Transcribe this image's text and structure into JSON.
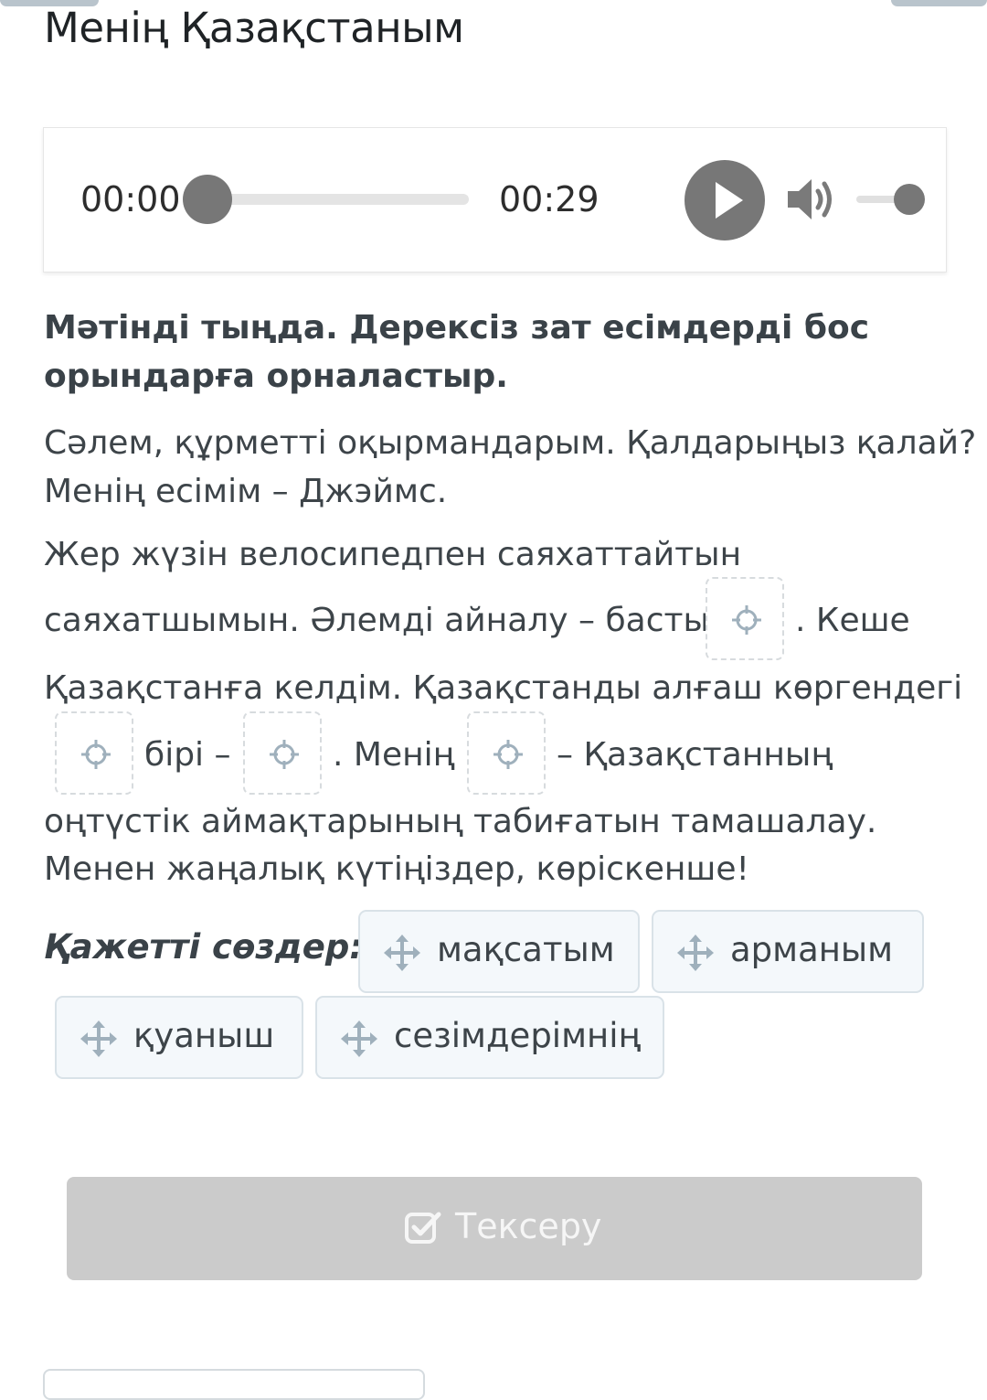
{
  "page": {
    "title": "Менің Қазақстаным"
  },
  "player": {
    "current_time": "00:00",
    "total_time": "00:29",
    "progress": 0.0,
    "volume": 1.0,
    "icons": {
      "play": "play-icon",
      "volume": "volume-icon"
    }
  },
  "exercise": {
    "instruction": "Мәтінді тыңда. Дерексіз зат есімдерді бос орындарға орналастыр.",
    "text": {
      "p1_line1": "Сәлем, құрметті оқырмандарым. Қалдарыңыз қалай?",
      "p1_line2": "Менің есімім – Джэймс.",
      "p2_line1": "Жер жүзін велосипедпен саяхаттайтын",
      "p2_line2_a": "саяхатшымын. Әлемді айналу – басты",
      "p2_line2_b": ". Кеше",
      "p2_line3": "Қазақстанға келдім. Қазақстанды алғаш көргендегі",
      "p2_line4_a": "бірі –",
      "p2_line4_b": ". Менің",
      "p2_line4_c": "– Қазақстанның",
      "p2_line5": "оңтүстік аймақтарының табиғатын тамашалау.",
      "p2_line6": "Менен жаңалық күтіңіздер, көріскенше!"
    },
    "words_label": "Қажетті сөздер:",
    "words": [
      "мақсатым",
      "арманым",
      "қуаныш",
      "сезімдерімнің"
    ],
    "check_button": "Тексеру"
  },
  "colors": {
    "control_gray": "#777777",
    "chip_bg": "#f4f8fb",
    "chip_border": "#d9e2e8",
    "button_disabled": "#cbcbcb",
    "icon_blue_gray": "#9fb0bc"
  }
}
